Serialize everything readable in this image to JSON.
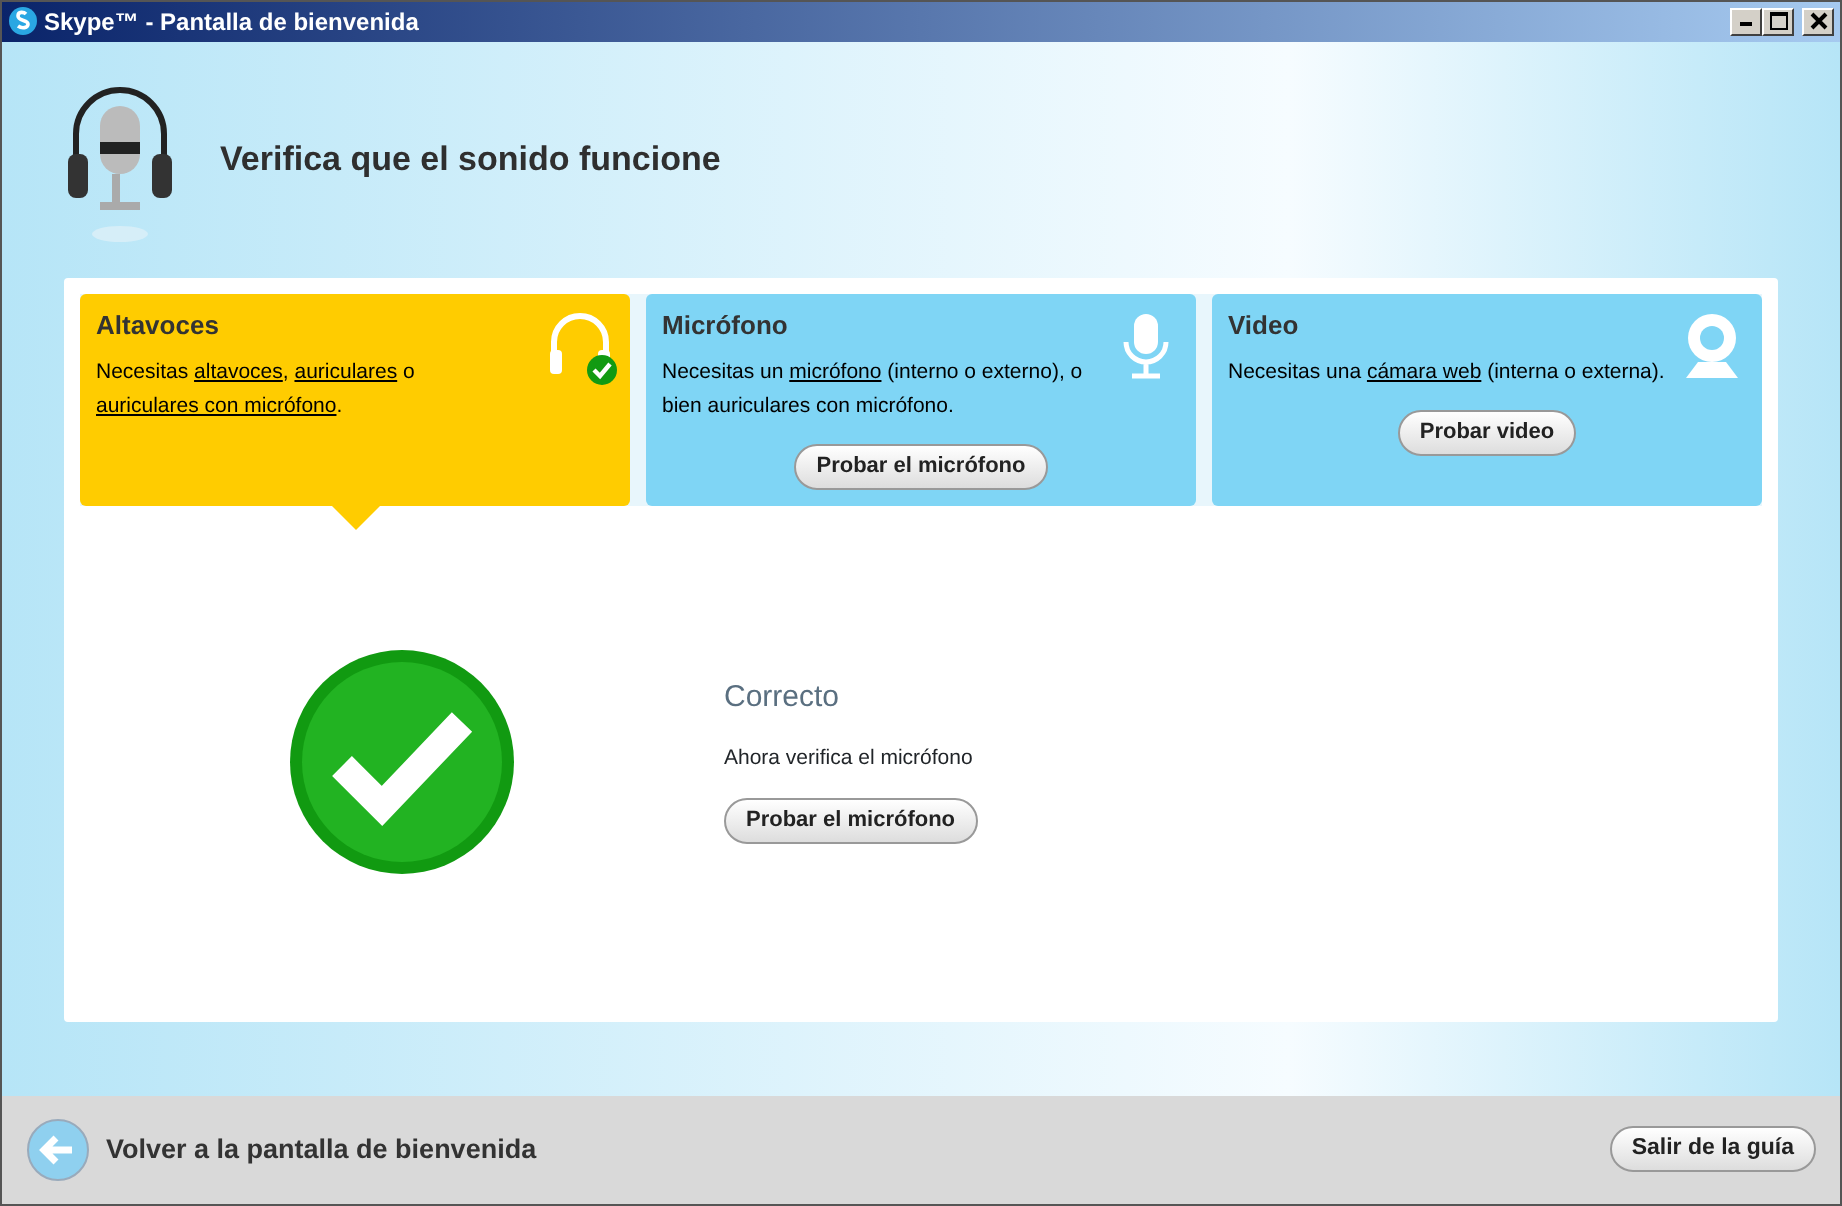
{
  "window": {
    "title": "Skype™ - Pantalla de bienvenida"
  },
  "header": {
    "title": "Verifica que el sonido funcione"
  },
  "cards": [
    {
      "kind": "headphones",
      "title": "Altavoces",
      "selected": true,
      "checked": true,
      "description": [
        {
          "text": "Necesitas "
        },
        {
          "text": "altavoces",
          "link": true
        },
        {
          "text": ", "
        },
        {
          "text": "auriculares",
          "link": true
        },
        {
          "text": " o "
        },
        {
          "text": "auriculares con micrófono",
          "link": true
        },
        {
          "text": "."
        }
      ]
    },
    {
      "kind": "microphone",
      "title": "Micrófono",
      "selected": false,
      "checked": false,
      "description": [
        {
          "text": "Necesitas un "
        },
        {
          "text": "micrófono",
          "link": true
        },
        {
          "text": " (interno o externo), o bien auriculares con micrófono."
        }
      ],
      "button": "Probar el micrófono"
    },
    {
      "kind": "camera",
      "title": "Video",
      "selected": false,
      "checked": false,
      "description": [
        {
          "text": "Necesitas una "
        },
        {
          "text": "cámara web",
          "link": true
        },
        {
          "text": " (interna o externa)."
        }
      ],
      "button": "Probar video"
    }
  ],
  "result": {
    "status": "Correcto",
    "message": "Ahora verifica el micrófono",
    "button": "Probar el micrófono"
  },
  "footer": {
    "back": "Volver a la pantalla de bienvenida",
    "exit": "Salir de la guía"
  }
}
